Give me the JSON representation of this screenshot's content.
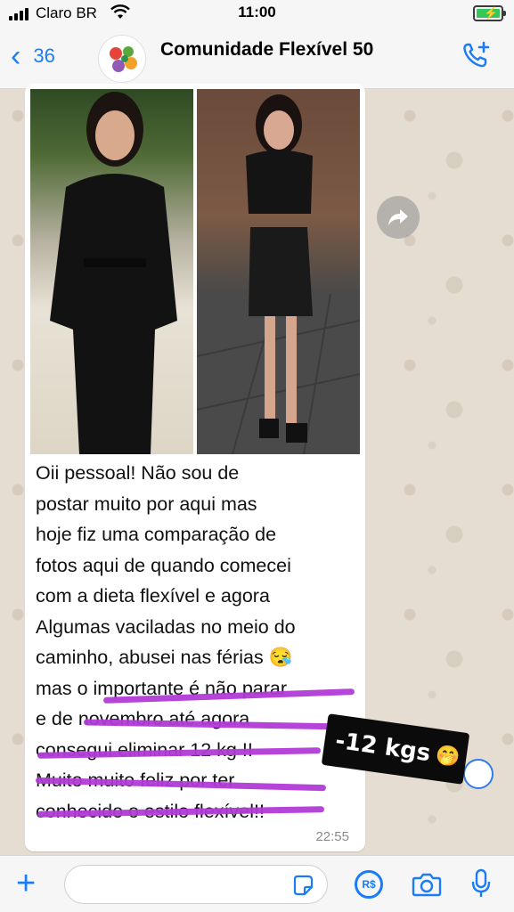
{
  "status_bar": {
    "carrier": "Claro BR",
    "time": "11:00"
  },
  "header": {
    "back_count": "36",
    "title": "Comunidade Flexível 50"
  },
  "message": {
    "lines": [
      "Oii pessoal! Não sou de",
      "postar muito por aqui mas",
      "hoje fiz uma comparação de",
      "fotos aqui de quando comecei",
      "com a dieta flexível e agora",
      "Algumas vaciladas no meio do",
      "caminho, abusei nas férias 😪",
      "mas o importante é não parar",
      "e de novembro até agora",
      "consegui eliminar 12 kg !!",
      "Muito muito feliz por ter",
      "conhecido o estilo flexível!!"
    ],
    "time": "22:55"
  },
  "sticker": {
    "text": "-12 kgs",
    "emoji": "🤭"
  },
  "composer": {
    "placeholder": "",
    "currency_label": "R$"
  },
  "colors": {
    "accent": "#1b7cf5",
    "highlight": "#b13ad6",
    "bubble": "#ffffff"
  }
}
